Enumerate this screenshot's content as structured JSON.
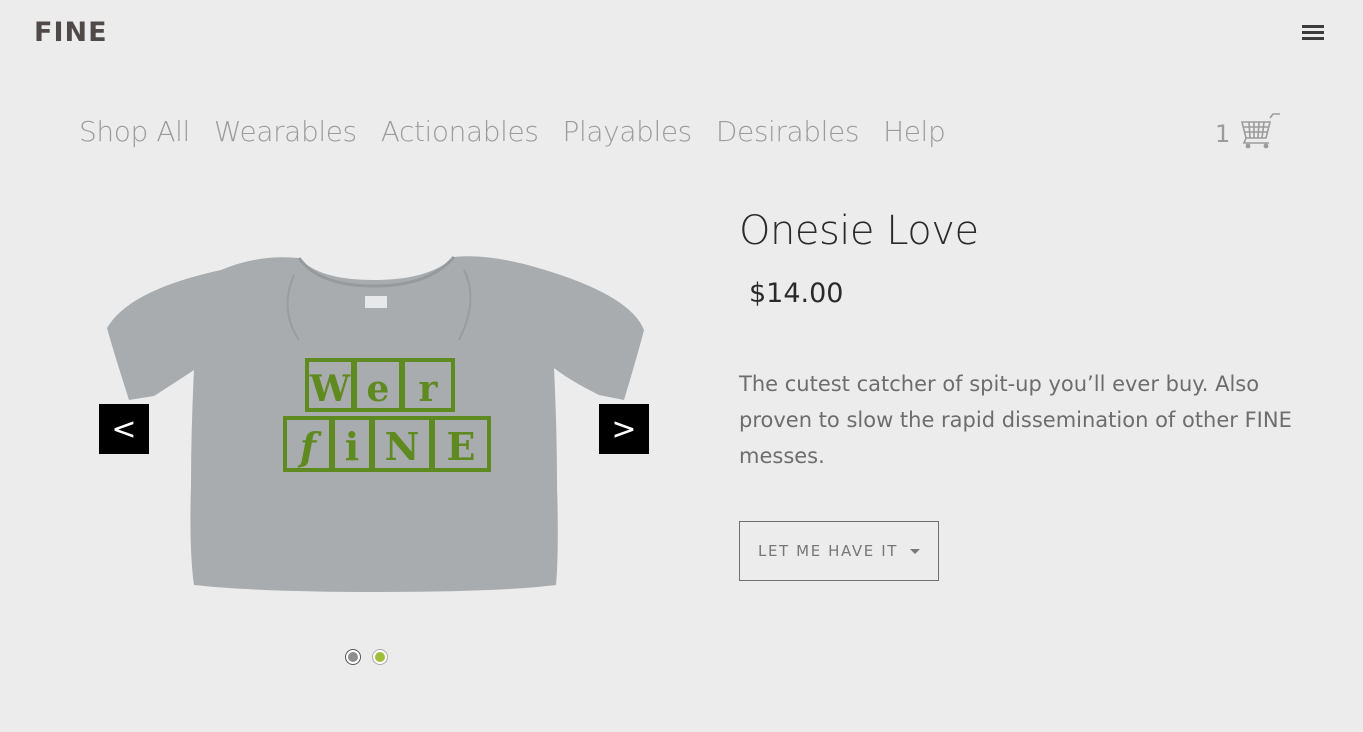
{
  "header": {
    "logo_text": "FINE",
    "menu_icon": "hamburger-icon"
  },
  "nav": {
    "items": [
      {
        "label": "Shop All"
      },
      {
        "label": "Wearables"
      },
      {
        "label": "Actionables"
      },
      {
        "label": "Playables"
      },
      {
        "label": "Desirables"
      },
      {
        "label": "Help"
      }
    ]
  },
  "cart": {
    "count": "1",
    "icon": "cart-icon"
  },
  "product": {
    "title": "Onesie Love",
    "price": "$14.00",
    "description": "The cutest catcher of spit-up you’ll ever buy. Also proven to slow the rapid dissemination of other FINE messes.",
    "buy_label": "LET ME HAVE IT",
    "image_alt": "Grey onesie with green block letters",
    "image_blocks_row1": [
      "W",
      "e",
      "r"
    ],
    "image_blocks_row2": [
      "f",
      "i",
      "N",
      "E"
    ]
  },
  "carousel": {
    "prev_label": "<",
    "next_label": ">",
    "active_dot": 2,
    "dot_count": 2,
    "dot_colors": [
      "#8e8e8e",
      "#9fbe3a"
    ]
  },
  "colors": {
    "background": "#ececec",
    "nav_text": "#9b9b9b",
    "onesie": "#a9acae",
    "print_green": "#5f8a1f"
  }
}
